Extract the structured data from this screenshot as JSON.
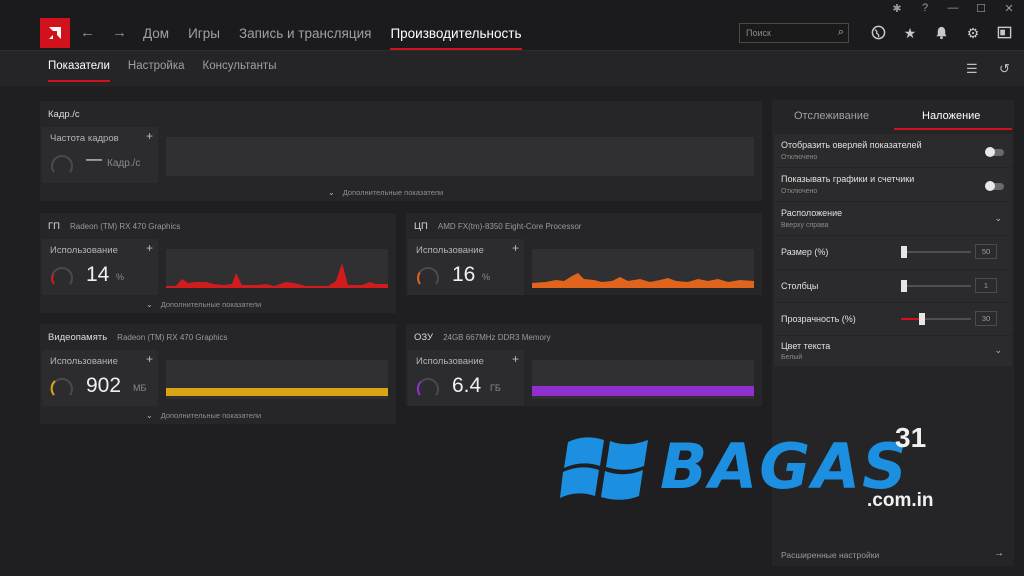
{
  "window": {
    "buttons": [
      {
        "name": "bug-icon",
        "glyph": "✱"
      },
      {
        "name": "help-icon",
        "glyph": "?"
      },
      {
        "name": "minimize-icon",
        "glyph": "—"
      },
      {
        "name": "maximize-icon",
        "glyph": "☐"
      },
      {
        "name": "close-icon",
        "glyph": "✕"
      }
    ]
  },
  "header": {
    "back_icon": "←",
    "forward_icon": "→",
    "nav": [
      "Дом",
      "Игры",
      "Запись и трансляция",
      "Производительность"
    ],
    "active_nav_index": 3,
    "search_placeholder": "Поиск",
    "search_icon": "⌕",
    "icons": [
      "globe-icon",
      "star-icon",
      "bell-icon",
      "gear-icon",
      "layout-icon"
    ]
  },
  "subheader": {
    "tabs": [
      "Показатели",
      "Настройка",
      "Консультанты"
    ],
    "active_tab_index": 0,
    "list_icon": "☰",
    "reset_icon": "↺"
  },
  "fps": {
    "title": "Кадр./с",
    "tile_label": "Частота кадров",
    "value": "—",
    "unit": "Кадр./с",
    "more": "Дополнительные показатели"
  },
  "gpu": {
    "title": "ГП",
    "subtitle": "Radeon (TM) RX 470 Graphics",
    "tile_label": "Использование",
    "value": "14",
    "unit": "%",
    "more": "Дополнительные показатели",
    "color": "#d01c1c"
  },
  "cpu": {
    "title": "ЦП",
    "subtitle": "AMD FX(tm)-8350 Eight-Core Processor",
    "tile_label": "Использование",
    "value": "16",
    "unit": "%",
    "color": "#e0641c"
  },
  "vram": {
    "title": "Видеопамять",
    "subtitle": "Radeon (TM) RX 470 Graphics",
    "tile_label": "Использование",
    "value": "902",
    "unit": "МБ",
    "more": "Дополнительные показатели",
    "color": "#d9a514"
  },
  "ram": {
    "title": "ОЗУ",
    "subtitle": "24GB 667MHz DDR3 Memory",
    "tile_label": "Использование",
    "value": "6.4",
    "unit": "ГБ",
    "color": "#8f2fd0"
  },
  "right": {
    "tabs": [
      "Отслеживание",
      "Наложение"
    ],
    "active_tab_index": 1,
    "overlay_label": "Отобразить оверлей показателей",
    "overlay_state": "Отключено",
    "graphs_label": "Показывать графики и счетчики",
    "graphs_state": "Отключено",
    "position_label": "Расположение",
    "position_value": "Вверху справа",
    "size_label": "Размер (%)",
    "size_value": "50",
    "size_level": 0,
    "columns_label": "Столбцы",
    "columns_value": "1",
    "columns_level": 0,
    "transparency_label": "Прозрачность (%)",
    "transparency_value": "30",
    "transparency_level": 0.3,
    "text_color_label": "Цвет текста",
    "text_color_value": "Белый",
    "advanced": "Расширенные настройки"
  },
  "watermark": {
    "brand": "BAGAS",
    "number": "31",
    "domain": ".com.in"
  }
}
